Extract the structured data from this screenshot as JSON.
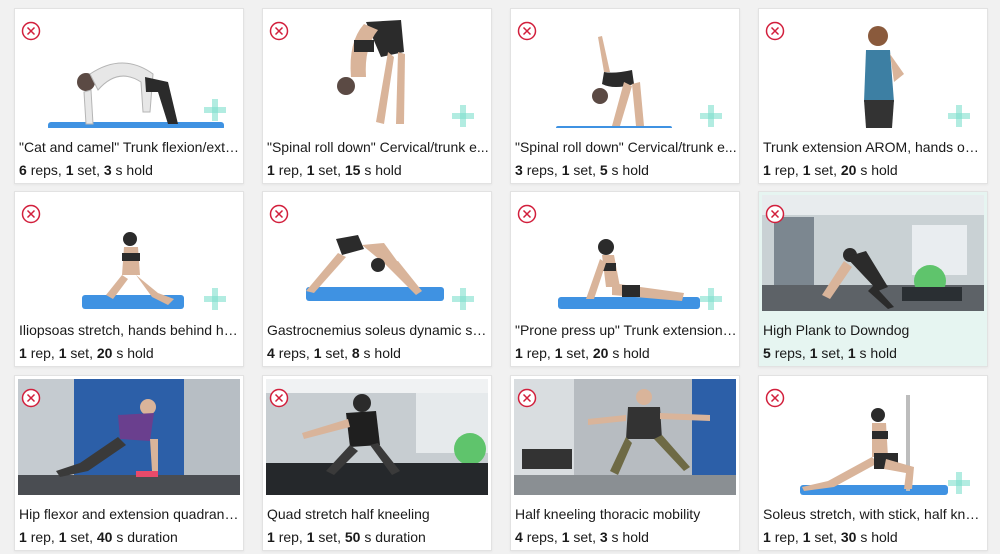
{
  "colors": {
    "accent": "#d21f3c",
    "plus": "#7fe0cd",
    "mat": "#3f92e2",
    "highlight": "#e6f5f1"
  },
  "icons": {
    "remove": "circle-x-icon",
    "add": "plus-icon"
  },
  "exercises": [
    {
      "title": "\"Cat and camel\" Trunk flexion/exte...",
      "count": "6",
      "count_unit": "reps",
      "sets": "1",
      "sets_unit": "set",
      "time": "3",
      "time_unit": "s hold"
    },
    {
      "title": "\"Spinal roll down\" Cervical/trunk e...",
      "count": "1",
      "count_unit": "rep",
      "sets": "1",
      "sets_unit": "set",
      "time": "15",
      "time_unit": "s hold"
    },
    {
      "title": "\"Spinal roll down\" Cervical/trunk e...",
      "count": "3",
      "count_unit": "reps",
      "sets": "1",
      "sets_unit": "set",
      "time": "5",
      "time_unit": "s hold"
    },
    {
      "title": "Trunk extension AROM, hands on ...",
      "count": "1",
      "count_unit": "rep",
      "sets": "1",
      "sets_unit": "set",
      "time": "20",
      "time_unit": "s hold"
    },
    {
      "title": "Iliopsoas stretch, hands behind he...",
      "count": "1",
      "count_unit": "rep",
      "sets": "1",
      "sets_unit": "set",
      "time": "20",
      "time_unit": "s hold"
    },
    {
      "title": "Gastrocnemius soleus dynamic str...",
      "count": "4",
      "count_unit": "reps",
      "sets": "1",
      "sets_unit": "set",
      "time": "8",
      "time_unit": "s hold"
    },
    {
      "title": "\"Prone press up\" Trunk extension ...",
      "count": "1",
      "count_unit": "rep",
      "sets": "1",
      "sets_unit": "set",
      "time": "20",
      "time_unit": "s hold"
    },
    {
      "title": "High Plank to Downdog",
      "count": "5",
      "count_unit": "reps",
      "sets": "1",
      "sets_unit": "set",
      "time": "1",
      "time_unit": "s hold"
    },
    {
      "title": "Hip flexor and extension quadrant ...",
      "count": "1",
      "count_unit": "rep",
      "sets": "1",
      "sets_unit": "set",
      "time": "40",
      "time_unit": "s duration"
    },
    {
      "title": "Quad stretch half kneeling",
      "count": "1",
      "count_unit": "rep",
      "sets": "1",
      "sets_unit": "set",
      "time": "50",
      "time_unit": "s duration"
    },
    {
      "title": "Half kneeling thoracic mobility",
      "count": "4",
      "count_unit": "reps",
      "sets": "1",
      "sets_unit": "set",
      "time": "3",
      "time_unit": "s hold"
    },
    {
      "title": "Soleus stretch, with stick, half knee...",
      "count": "1",
      "count_unit": "rep",
      "sets": "1",
      "sets_unit": "set",
      "time": "30",
      "time_unit": "s hold"
    }
  ]
}
